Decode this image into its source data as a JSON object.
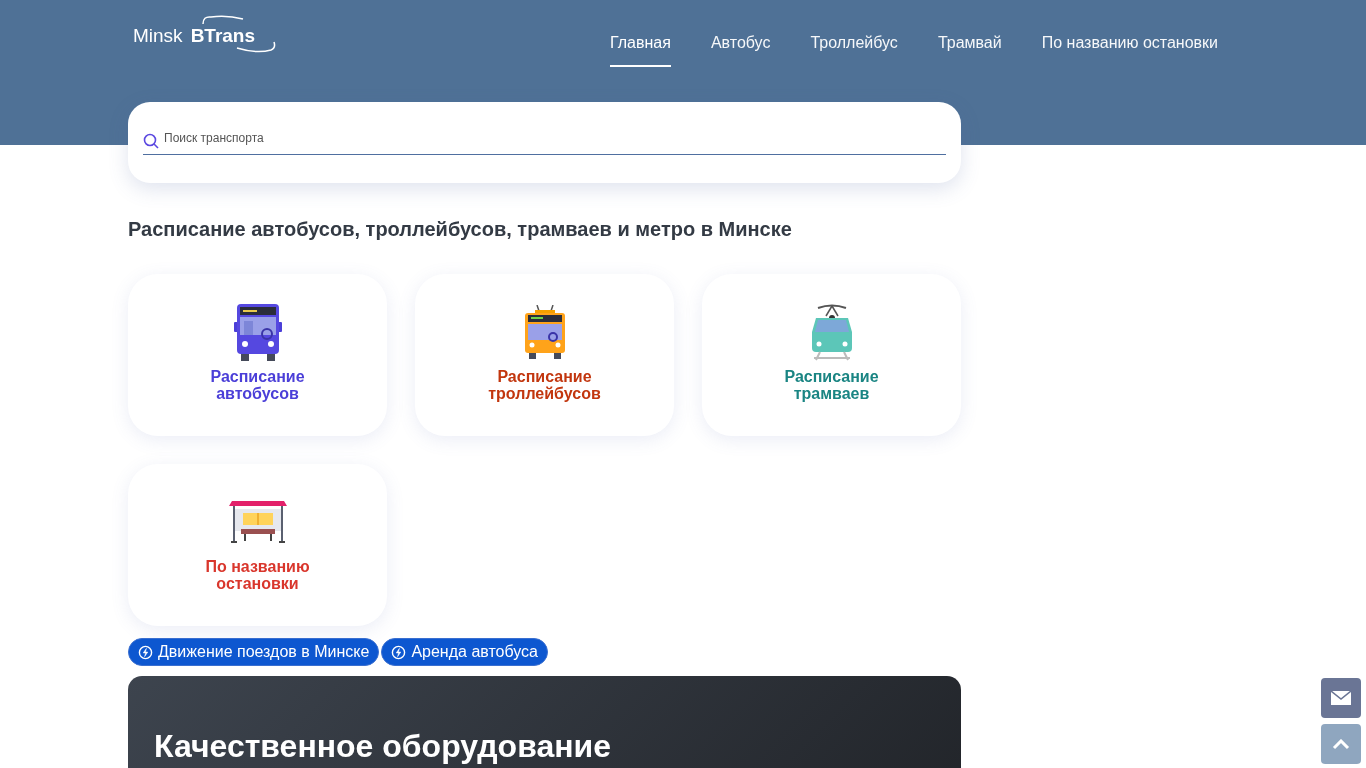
{
  "logo": {
    "left": "Minsk",
    "right": "BTrans"
  },
  "nav": [
    {
      "label": "Главная",
      "selected": true
    },
    {
      "label": "Автобус",
      "selected": false
    },
    {
      "label": "Троллейбус",
      "selected": false
    },
    {
      "label": "Трамвай",
      "selected": false
    },
    {
      "label": "По названию остановки",
      "selected": false
    }
  ],
  "search": {
    "placeholder": "Поиск транспорта"
  },
  "heading": "Расписание автобусов, троллейбусов, трамваев и метро в Минске",
  "cards": [
    {
      "kind": "bus",
      "line1": "Расписание",
      "line2": "автобусов",
      "color": "#4b3fd8"
    },
    {
      "kind": "trolleybus",
      "line1": "Расписание",
      "line2": "троллейбусов",
      "color": "#c2360e"
    },
    {
      "kind": "tram",
      "line1": "Расписание",
      "line2": "трамваев",
      "color": "#1a8583"
    },
    {
      "kind": "stop",
      "line1": "По названию",
      "line2": "остановки",
      "color": "#d9362c"
    }
  ],
  "links": [
    "Движение поездов в Минске",
    "Аренда автобуса"
  ],
  "banner": {
    "title": "Качественное оборудование"
  }
}
